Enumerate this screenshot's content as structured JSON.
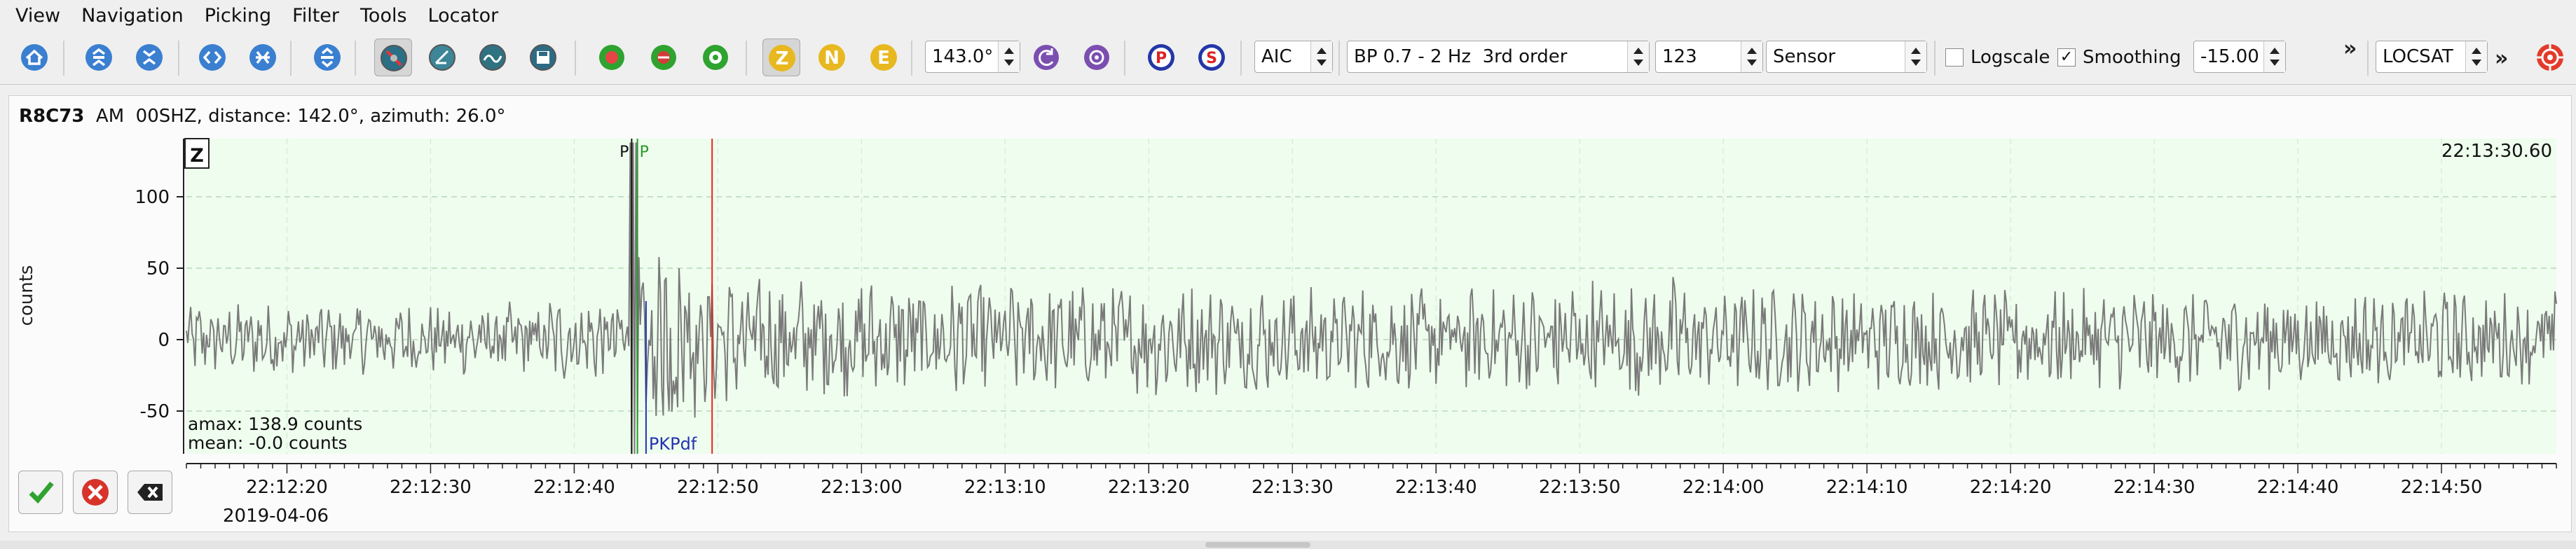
{
  "menu": [
    "View",
    "Navigation",
    "Picking",
    "Filter",
    "Tools",
    "Locator"
  ],
  "toolbar": {
    "azimuth_value": "143.0°",
    "picker": "AIC",
    "filter": "BP 0.7 - 2 Hz  3rd order",
    "number_value": "123",
    "unit": "Sensor",
    "logscale_label": "Logscale",
    "logscale_checked": false,
    "smoothing_label": "Smoothing",
    "smoothing_checked": true,
    "smoothing_value": "-15.00",
    "overflow_glyph": "»",
    "locator": "LOCSAT",
    "icons": {
      "home": "home-icon",
      "scroll_up": "scroll-up-icon",
      "scroll_down": "scroll-down-icon",
      "prev": "previous-icon",
      "next": "next-icon",
      "align": "align-icon",
      "components": [
        "Z",
        "N",
        "E"
      ],
      "theoretical_phases": [
        "P",
        "S"
      ]
    }
  },
  "trace": {
    "station": "R8C73",
    "network_code": "AM",
    "channel_info": "00SHZ, distance: 142.0°, azimuth: 26.0°",
    "component": "Z",
    "ylabel": "counts",
    "time_label": "22:13:30.60",
    "amax": "amax: 138.9 counts",
    "mean": "mean: -0.0 counts",
    "date": "2019-04-06",
    "colors": {
      "background": "#eefded",
      "waveform": "#7a7a7a",
      "pick_p": "#2a9a2a",
      "theoretical": "#2333b0",
      "cursor": "#e8231b"
    }
  },
  "chart_data": {
    "type": "line",
    "series": [
      {
        "values_note_only": false
      }
    ],
    "yticks": [
      100,
      50,
      0,
      -50
    ],
    "ylim": [
      -80,
      140
    ],
    "xticks": [
      "22:12:20",
      "22:12:30",
      "22:12:40",
      "22:12:50",
      "22:13:00",
      "22:13:10",
      "22:13:20",
      "22:13:30",
      "22:13:40",
      "22:13:50",
      "22:14:00",
      "22:14:10",
      "22:14:20",
      "22:14:30",
      "22:14:40",
      "22:14:50"
    ],
    "picks": [
      {
        "label": "P",
        "time_s": 31.0,
        "kind": "manual"
      },
      {
        "label": "P",
        "time_s": 31.4,
        "kind": "automatic"
      },
      {
        "label": "PKPdf",
        "time_s": 32.0,
        "kind": "theoretical"
      },
      {
        "label": "",
        "time_s": 36.6,
        "kind": "cursor"
      }
    ],
    "x_start": "22:12:13",
    "x_end": "22:14:58",
    "grid": true
  }
}
